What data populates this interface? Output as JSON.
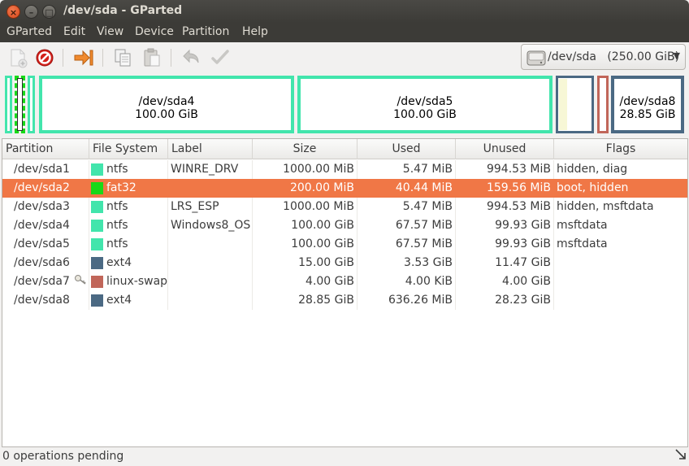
{
  "window": {
    "title": "/dev/sda - GParted"
  },
  "menu": [
    "GParted",
    "Edit",
    "View",
    "Device",
    "Partition",
    "Help"
  ],
  "toolbar": {
    "icons": [
      "new-icon",
      "delete-icon",
      "resize-move-icon",
      "copy-icon",
      "paste-icon",
      "undo-icon",
      "apply-icon"
    ]
  },
  "device": {
    "path": "/dev/sda",
    "size": "(250.00 GiB)"
  },
  "partition_map": [
    {
      "name": "/dev/sda4",
      "size": "100.00 GiB"
    },
    {
      "name": "/dev/sda5",
      "size": "100.00 GiB"
    },
    {
      "name": "/dev/sda8",
      "size": "28.85 GiB"
    }
  ],
  "table": {
    "columns": [
      "Partition",
      "File System",
      "Label",
      "Size",
      "Used",
      "Unused",
      "Flags"
    ],
    "rows": [
      {
        "partition": "/dev/sda1",
        "fs": "ntfs",
        "fs_color": "#42e5ac",
        "label": "WINRE_DRV",
        "size": "1000.00 MiB",
        "used": "5.47 MiB",
        "unused": "994.53 MiB",
        "flags": "hidden, diag"
      },
      {
        "partition": "/dev/sda2",
        "fs": "fat32",
        "fs_color": "#18d918",
        "label": "",
        "size": "200.00 MiB",
        "used": "40.44 MiB",
        "unused": "159.56 MiB",
        "flags": "boot, hidden"
      },
      {
        "partition": "/dev/sda3",
        "fs": "ntfs",
        "fs_color": "#42e5ac",
        "label": "LRS_ESP",
        "size": "1000.00 MiB",
        "used": "5.47 MiB",
        "unused": "994.53 MiB",
        "flags": "hidden, msftdata"
      },
      {
        "partition": "/dev/sda4",
        "fs": "ntfs",
        "fs_color": "#42e5ac",
        "label": "Windows8_OS",
        "size": "100.00 GiB",
        "used": "67.57 MiB",
        "unused": "99.93 GiB",
        "flags": "msftdata"
      },
      {
        "partition": "/dev/sda5",
        "fs": "ntfs",
        "fs_color": "#42e5ac",
        "label": "",
        "size": "100.00 GiB",
        "used": "67.57 MiB",
        "unused": "99.93 GiB",
        "flags": "msftdata"
      },
      {
        "partition": "/dev/sda6",
        "fs": "ext4",
        "fs_color": "#4b6983",
        "label": "",
        "size": "15.00 GiB",
        "used": "3.53 GiB",
        "unused": "11.47 GiB",
        "flags": ""
      },
      {
        "partition": "/dev/sda7",
        "fs": "linux-swap",
        "fs_color": "#c1665a",
        "label": "",
        "size": "4.00 GiB",
        "used": "4.00 KiB",
        "unused": "4.00 GiB",
        "flags": ""
      },
      {
        "partition": "/dev/sda8",
        "fs": "ext4",
        "fs_color": "#4b6983",
        "label": "",
        "size": "28.85 GiB",
        "used": "636.26 MiB",
        "unused": "28.23 GiB",
        "flags": ""
      }
    ],
    "selected_row": 1
  },
  "status": {
    "text": "0 operations pending"
  }
}
